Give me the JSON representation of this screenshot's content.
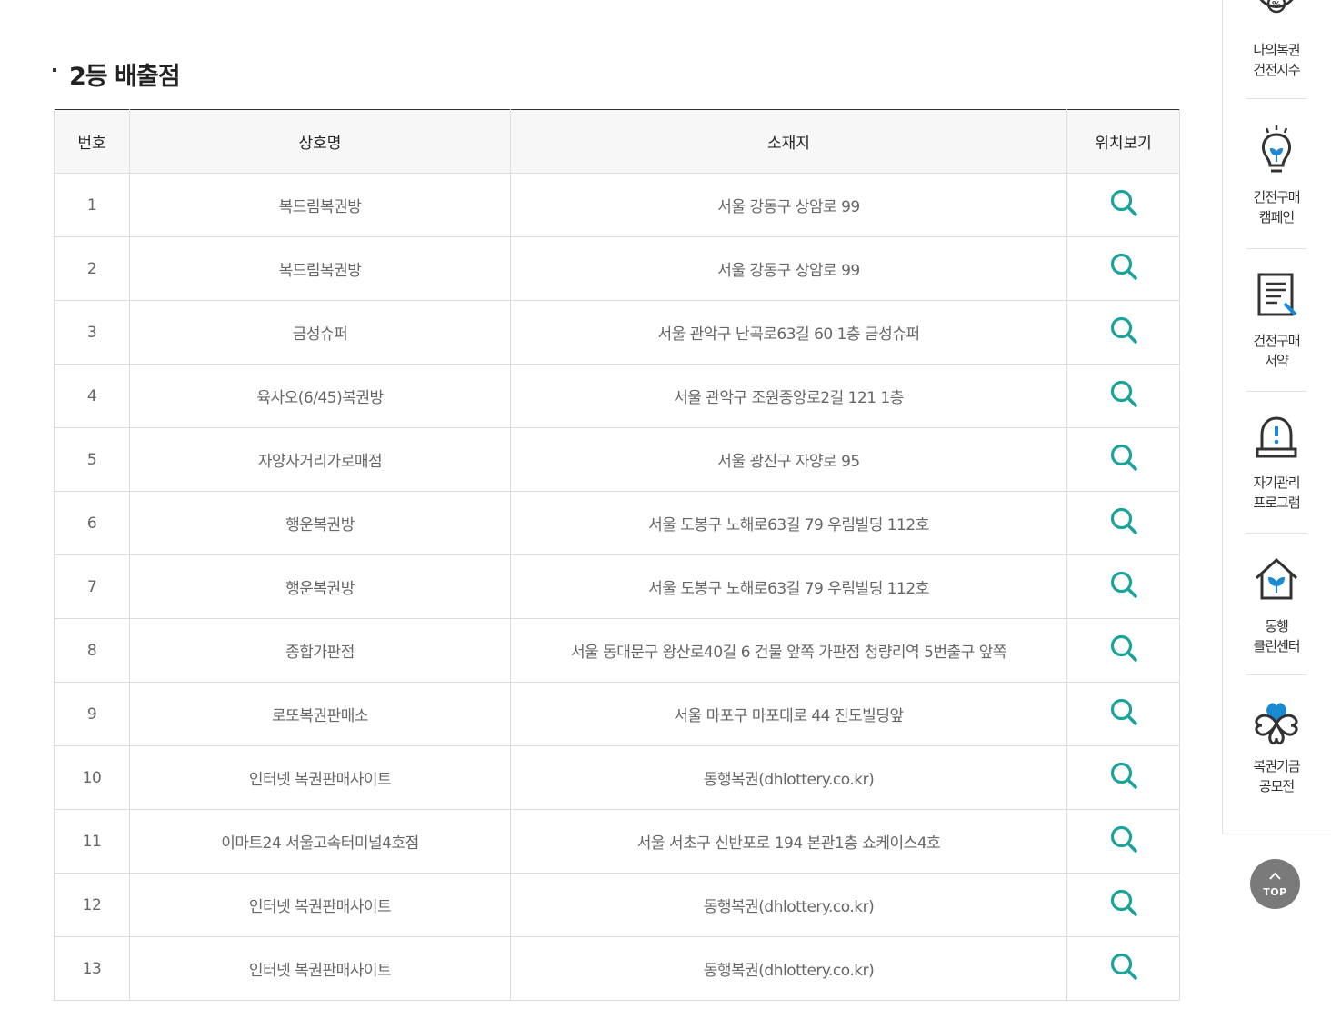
{
  "section": {
    "title": "2등 배출점"
  },
  "table": {
    "headers": {
      "no": "번호",
      "name": "상호명",
      "address": "소재지",
      "location": "위치보기"
    },
    "rows": [
      {
        "no": "1",
        "name": "복드림복권방",
        "address": "서울 강동구 상암로 99"
      },
      {
        "no": "2",
        "name": "복드림복권방",
        "address": "서울 강동구 상암로 99"
      },
      {
        "no": "3",
        "name": "금성슈퍼",
        "address": "서울 관악구 난곡로63길 60 1층 금성슈퍼"
      },
      {
        "no": "4",
        "name": "육사오(6/45)복권방",
        "address": "서울 관악구 조원중앙로2길 121 1층"
      },
      {
        "no": "5",
        "name": "자양사거리가로매점",
        "address": "서울 광진구 자양로 95"
      },
      {
        "no": "6",
        "name": "행운복권방",
        "address": "서울 도봉구 노해로63길 79 우림빌딩 112호"
      },
      {
        "no": "7",
        "name": "행운복권방",
        "address": "서울 도봉구 노해로63길 79 우림빌딩 112호"
      },
      {
        "no": "8",
        "name": "종합가판점",
        "address": "서울 동대문구 왕산로40길 6 건물 앞쪽 가판점 청량리역 5번출구 앞쪽"
      },
      {
        "no": "9",
        "name": "로또복권판매소",
        "address": "서울 마포구 마포대로 44 진도빌딩앞"
      },
      {
        "no": "10",
        "name": "인터넷 복권판매사이트",
        "address": "동행복권(dhlottery.co.kr)"
      },
      {
        "no": "11",
        "name": "이마트24 서울고속터미널4호점",
        "address": "서울 서초구 신반포로 194 본관1층 쇼케이스4호"
      },
      {
        "no": "12",
        "name": "인터넷 복권판매사이트",
        "address": "동행복권(dhlottery.co.kr)"
      },
      {
        "no": "13",
        "name": "인터넷 복권판매사이트",
        "address": "동행복권(dhlottery.co.kr)"
      }
    ]
  },
  "quick_menu": {
    "items": [
      {
        "line1": "나의복권",
        "line2": "건전지수",
        "icon": "gauge-percent-icon"
      },
      {
        "line1": "건전구매",
        "line2": "캠페인",
        "icon": "lightbulb-icon"
      },
      {
        "line1": "건전구매",
        "line2": "서약",
        "icon": "document-pen-icon"
      },
      {
        "line1": "자기관리",
        "line2": "프로그램",
        "icon": "alarm-bell-icon"
      },
      {
        "line1": "동행",
        "line2": "클린센터",
        "icon": "house-sprout-icon"
      },
      {
        "line1": "복권기금",
        "line2": "공모전",
        "icon": "clover-icon"
      }
    ],
    "top_label": "TOP"
  },
  "colors": {
    "search_icon": "#1aa39a",
    "accent_blue": "#1a8ad4",
    "top_button": "#7a7a7a"
  }
}
